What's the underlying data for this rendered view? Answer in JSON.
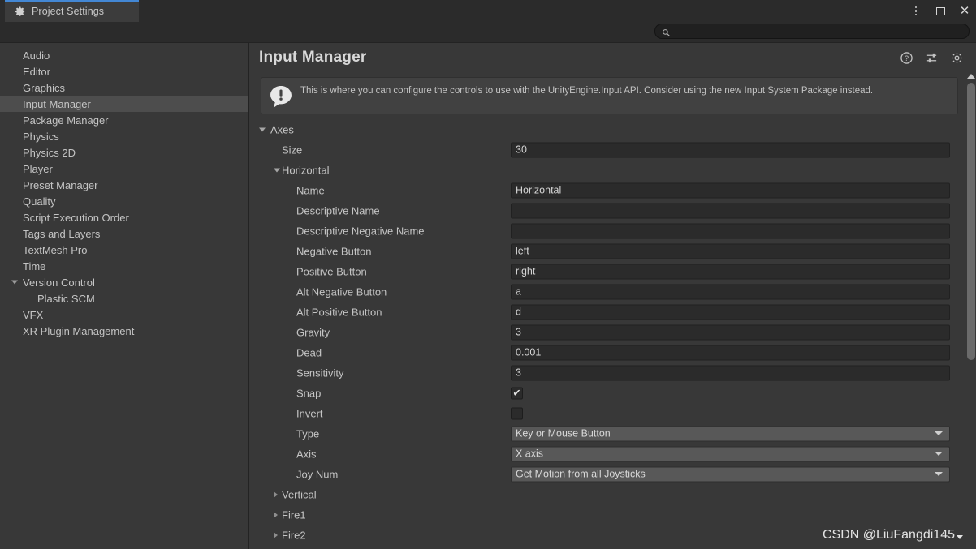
{
  "window": {
    "tab_label": "Project Settings",
    "tab_icon": "gear-icon",
    "accent_color": "#4387d4",
    "controls": [
      {
        "name": "more-options-button",
        "icon": "kebab-menu-icon"
      },
      {
        "name": "maximize-button",
        "icon": "maximize-icon"
      },
      {
        "name": "close-button",
        "icon": "close-icon",
        "glyph": "✕"
      }
    ]
  },
  "search": {
    "value": "",
    "placeholder": "",
    "icon": "search-icon"
  },
  "sidebar": {
    "items": [
      {
        "label": "Audio",
        "indent": 0,
        "foldout": "none",
        "selected": false
      },
      {
        "label": "Editor",
        "indent": 0,
        "foldout": "none",
        "selected": false
      },
      {
        "label": "Graphics",
        "indent": 0,
        "foldout": "none",
        "selected": false
      },
      {
        "label": "Input Manager",
        "indent": 0,
        "foldout": "none",
        "selected": true
      },
      {
        "label": "Package Manager",
        "indent": 0,
        "foldout": "none",
        "selected": false
      },
      {
        "label": "Physics",
        "indent": 0,
        "foldout": "none",
        "selected": false
      },
      {
        "label": "Physics 2D",
        "indent": 0,
        "foldout": "none",
        "selected": false
      },
      {
        "label": "Player",
        "indent": 0,
        "foldout": "none",
        "selected": false
      },
      {
        "label": "Preset Manager",
        "indent": 0,
        "foldout": "none",
        "selected": false
      },
      {
        "label": "Quality",
        "indent": 0,
        "foldout": "none",
        "selected": false
      },
      {
        "label": "Script Execution Order",
        "indent": 0,
        "foldout": "none",
        "selected": false
      },
      {
        "label": "Tags and Layers",
        "indent": 0,
        "foldout": "none",
        "selected": false
      },
      {
        "label": "TextMesh Pro",
        "indent": 0,
        "foldout": "none",
        "selected": false
      },
      {
        "label": "Time",
        "indent": 0,
        "foldout": "none",
        "selected": false
      },
      {
        "label": "Version Control",
        "indent": 0,
        "foldout": "open",
        "selected": false
      },
      {
        "label": "Plastic SCM",
        "indent": 1,
        "foldout": "none",
        "selected": false
      },
      {
        "label": "VFX",
        "indent": 0,
        "foldout": "none",
        "selected": false
      },
      {
        "label": "XR Plugin Management",
        "indent": 0,
        "foldout": "none",
        "selected": false
      }
    ]
  },
  "main": {
    "title": "Input Manager",
    "header_icons": [
      {
        "name": "help-icon"
      },
      {
        "name": "preset-icon"
      },
      {
        "name": "settings-gear-icon"
      }
    ],
    "banner": {
      "icon": "info-icon",
      "text": "This is where you can configure the controls to use with the UnityEngine.Input API. Consider using the new Input System Package instead."
    },
    "rows": [
      {
        "label": "Axes",
        "level": 0,
        "foldout": "open",
        "control": "none"
      },
      {
        "label": "Size",
        "level": 1,
        "foldout": "none",
        "control": "text",
        "value": "30"
      },
      {
        "label": "Horizontal",
        "level": 1,
        "foldout": "open",
        "control": "none"
      },
      {
        "label": "Name",
        "level": 2,
        "foldout": "none",
        "control": "text",
        "value": "Horizontal"
      },
      {
        "label": "Descriptive Name",
        "level": 2,
        "foldout": "none",
        "control": "text",
        "value": ""
      },
      {
        "label": "Descriptive Negative Name",
        "level": 2,
        "foldout": "none",
        "control": "text",
        "value": ""
      },
      {
        "label": "Negative Button",
        "level": 2,
        "foldout": "none",
        "control": "text",
        "value": "left"
      },
      {
        "label": "Positive Button",
        "level": 2,
        "foldout": "none",
        "control": "text",
        "value": "right"
      },
      {
        "label": "Alt Negative Button",
        "level": 2,
        "foldout": "none",
        "control": "text",
        "value": "a"
      },
      {
        "label": "Alt Positive Button",
        "level": 2,
        "foldout": "none",
        "control": "text",
        "value": "d"
      },
      {
        "label": "Gravity",
        "level": 2,
        "foldout": "none",
        "control": "text",
        "value": "3"
      },
      {
        "label": "Dead",
        "level": 2,
        "foldout": "none",
        "control": "text",
        "value": "0.001"
      },
      {
        "label": "Sensitivity",
        "level": 2,
        "foldout": "none",
        "control": "text",
        "value": "3"
      },
      {
        "label": "Snap",
        "level": 2,
        "foldout": "none",
        "control": "checkbox",
        "checked": true
      },
      {
        "label": "Invert",
        "level": 2,
        "foldout": "none",
        "control": "checkbox",
        "checked": false
      },
      {
        "label": "Type",
        "level": 2,
        "foldout": "none",
        "control": "dropdown",
        "value": "Key or Mouse Button"
      },
      {
        "label": "Axis",
        "level": 2,
        "foldout": "none",
        "control": "dropdown",
        "value": "X axis"
      },
      {
        "label": "Joy Num",
        "level": 2,
        "foldout": "none",
        "control": "dropdown",
        "value": "Get Motion from all Joysticks"
      },
      {
        "label": "Vertical",
        "level": 1,
        "foldout": "closed",
        "control": "none"
      },
      {
        "label": "Fire1",
        "level": 1,
        "foldout": "closed",
        "control": "none"
      },
      {
        "label": "Fire2",
        "level": 1,
        "foldout": "closed",
        "control": "none"
      }
    ]
  },
  "scrollbar": {
    "name": "vertical-scrollbar"
  },
  "watermark": {
    "text": "CSDN @LiuFangdi145"
  },
  "bleed": {
    "frag1": "s1",
    "frag2": "s"
  }
}
